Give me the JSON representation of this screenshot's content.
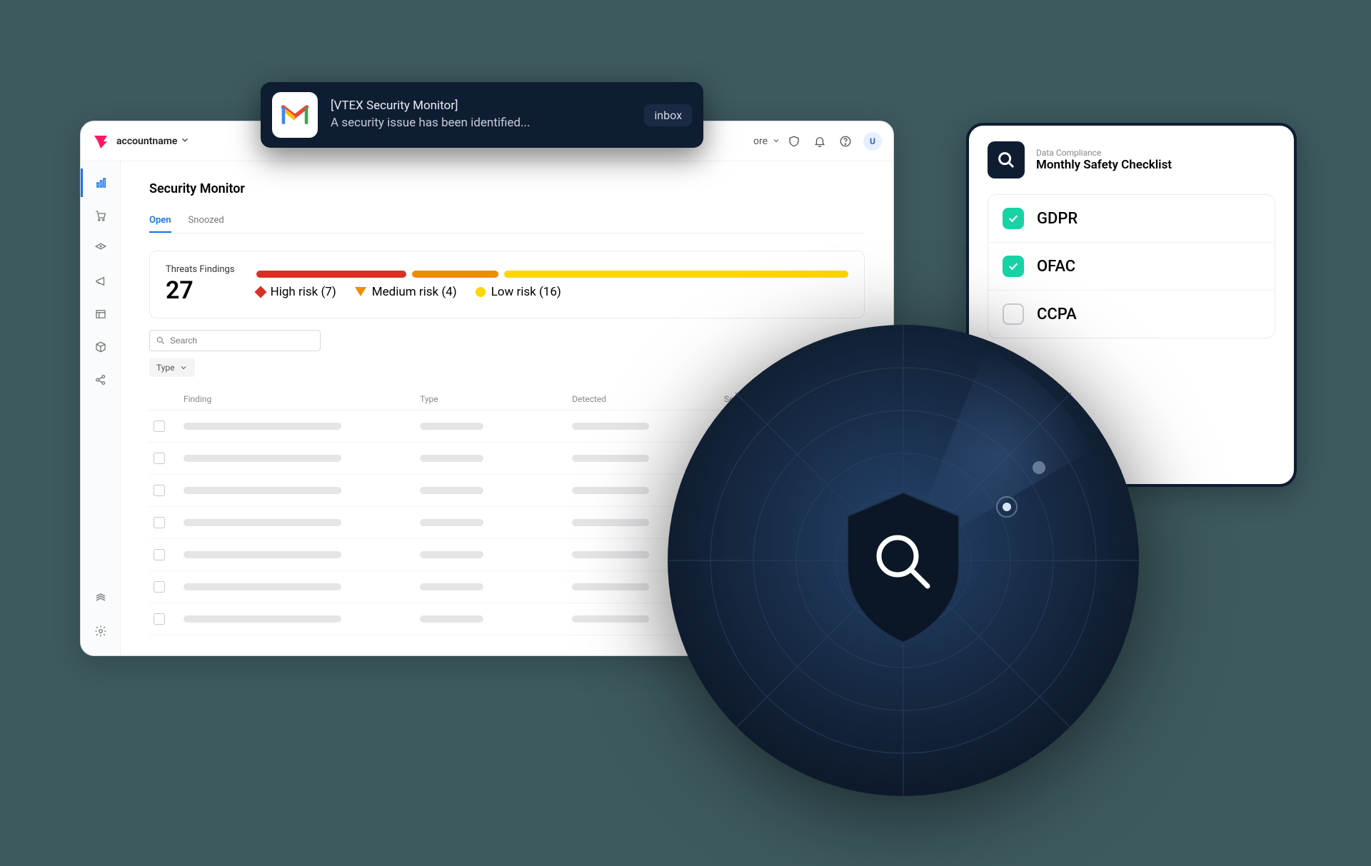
{
  "topbar": {
    "account_name": "accountname",
    "store_link": "ore",
    "avatar_initial": "U"
  },
  "page": {
    "title": "Security Monitor",
    "tabs": [
      {
        "label": "Open",
        "active": true
      },
      {
        "label": "Snoozed",
        "active": false
      }
    ]
  },
  "threats": {
    "label": "Threats Findings",
    "count": "27",
    "risks": {
      "high": {
        "label": "High risk (7)",
        "count": 7,
        "color": "#d93025"
      },
      "medium": {
        "label": "Medium risk (4)",
        "count": 4,
        "color": "#ef8c00"
      },
      "low": {
        "label": "Low risk (16)",
        "count": 16,
        "color": "#ffd600"
      }
    }
  },
  "search": {
    "placeholder": "Search"
  },
  "filters": {
    "type_label": "Type"
  },
  "table": {
    "columns": [
      "Finding",
      "Type",
      "Detected",
      "Sensor"
    ],
    "row_count": 7
  },
  "notification": {
    "title": "[VTEX Security Monitor]",
    "body": "A security issue has been identified...",
    "badge": "inbox"
  },
  "checklist": {
    "category": "Data Compliance",
    "title": "Monthly Safety Checklist",
    "items": [
      {
        "label": "GDPR",
        "checked": true
      },
      {
        "label": "OFAC",
        "checked": true
      },
      {
        "label": "CCPA",
        "checked": false
      }
    ]
  }
}
